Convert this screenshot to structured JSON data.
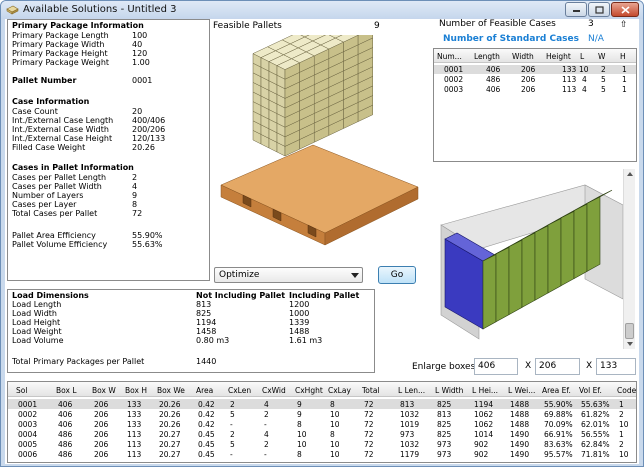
{
  "window": {
    "title": "Available Solutions - Untitled 3"
  },
  "info": {
    "primary_heading": "Primary Package Information",
    "primary": [
      {
        "label": "Primary Package Length",
        "value": "100"
      },
      {
        "label": "Primary Package Width",
        "value": "40"
      },
      {
        "label": "Primary Package Height",
        "value": "120"
      },
      {
        "label": "Primary Package Weight",
        "value": "1.00"
      }
    ],
    "pallet_number_label": "Pallet Number",
    "pallet_number_value": "0001",
    "case_heading": "Case Information",
    "case": [
      {
        "label": "Case Count",
        "value": "20"
      },
      {
        "label": "Int./External Case Length",
        "value": "400/406"
      },
      {
        "label": "Int./External Case Width",
        "value": "200/206"
      },
      {
        "label": "Int./External Case Height",
        "value": "120/133"
      },
      {
        "label": "Filled Case Weight",
        "value": "20.26"
      }
    ],
    "cases_pallet_heading": "Cases in Pallet Information",
    "cases_pallet": [
      {
        "label": "Cases per Pallet Length",
        "value": "2"
      },
      {
        "label": "Cases per Pallet Width",
        "value": "4"
      },
      {
        "label": "Number of Layers",
        "value": "9"
      },
      {
        "label": "Cases per Layer",
        "value": "8"
      },
      {
        "label": "Total Cases per Pallet",
        "value": "72"
      }
    ],
    "efficiency": [
      {
        "label": "Pallet Area Efficiency",
        "value": "55.90%"
      },
      {
        "label": "Pallet Volume Efficiency",
        "value": "55.63%"
      }
    ]
  },
  "feasible_pallets": {
    "label": "Feasible Pallets",
    "value": "9"
  },
  "feasible_cases": {
    "label": "Number of Feasible Cases",
    "value": "3"
  },
  "standard_cases": {
    "label": "Number of Standard Cases",
    "value": "N/A",
    "color": "#1a7fd4"
  },
  "cases_table": {
    "headers": [
      "Num...",
      "Length",
      "Width",
      "Height",
      "L",
      "W",
      "H"
    ],
    "rows": [
      [
        "0001",
        "406",
        "206",
        "133",
        "10",
        "2",
        "1"
      ],
      [
        "0002",
        "486",
        "206",
        "113",
        "4",
        "5",
        "1"
      ],
      [
        "0003",
        "406",
        "206",
        "113",
        "4",
        "5",
        "1"
      ]
    ]
  },
  "optimize": {
    "selected": "Optimize",
    "go_label": "Go"
  },
  "load": {
    "heading": "Load Dimensions",
    "col1": "Not Including Pallet",
    "col2": "Including Pallet",
    "rows": [
      {
        "label": "Load Length",
        "v1": "813",
        "v2": "1200"
      },
      {
        "label": "Load Width",
        "v1": "825",
        "v2": "1000"
      },
      {
        "label": "Load Height",
        "v1": "1194",
        "v2": "1339"
      },
      {
        "label": "Load Weight",
        "v1": "1458",
        "v2": "1488"
      },
      {
        "label": "Load Volume",
        "v1": "0.80 m3",
        "v2": "1.61 m3"
      }
    ],
    "total_label": "Total Primary Packages per Pallet",
    "total_value": "1440"
  },
  "enlarge": {
    "label": "Enlarge boxes",
    "x_label": "X",
    "v1": "406",
    "v2": "206",
    "v3": "133"
  },
  "solutions": {
    "headers": [
      "Sol",
      "Box L",
      "Box W",
      "Box H",
      "Box We",
      "Area",
      "CxLen",
      "CxWid",
      "CxHght",
      "CxLay",
      "Total",
      "L Len...",
      "L Width",
      "L Hei...",
      "L Wei...",
      "Area Ef.",
      "Vol Ef.",
      "Code"
    ],
    "rows": [
      [
        "0001",
        "406",
        "206",
        "133",
        "20.26",
        "0.42",
        "2",
        "4",
        "9",
        "8",
        "72",
        "813",
        "825",
        "1194",
        "1488",
        "55.90%",
        "55.63%",
        "1"
      ],
      [
        "0002",
        "406",
        "206",
        "133",
        "20.26",
        "0.42",
        "5",
        "2",
        "9",
        "10",
        "72",
        "1032",
        "813",
        "1062",
        "1488",
        "69.88%",
        "61.82%",
        "2"
      ],
      [
        "0003",
        "406",
        "206",
        "133",
        "20.26",
        "0.42",
        "-",
        "-",
        "8",
        "10",
        "72",
        "1019",
        "825",
        "1062",
        "1488",
        "70.09%",
        "62.01%",
        "10"
      ],
      [
        "0004",
        "486",
        "206",
        "113",
        "20.27",
        "0.45",
        "2",
        "4",
        "10",
        "8",
        "72",
        "973",
        "825",
        "1014",
        "1490",
        "66.91%",
        "56.55%",
        "1"
      ],
      [
        "0005",
        "486",
        "206",
        "113",
        "20.27",
        "0.45",
        "5",
        "2",
        "10",
        "10",
        "72",
        "1032",
        "973",
        "902",
        "1490",
        "83.63%",
        "62.84%",
        "2"
      ],
      [
        "0006",
        "486",
        "206",
        "113",
        "20.27",
        "0.45",
        "-",
        "-",
        "8",
        "10",
        "72",
        "1179",
        "973",
        "902",
        "1490",
        "95.57%",
        "71.81%",
        "10"
      ]
    ]
  }
}
